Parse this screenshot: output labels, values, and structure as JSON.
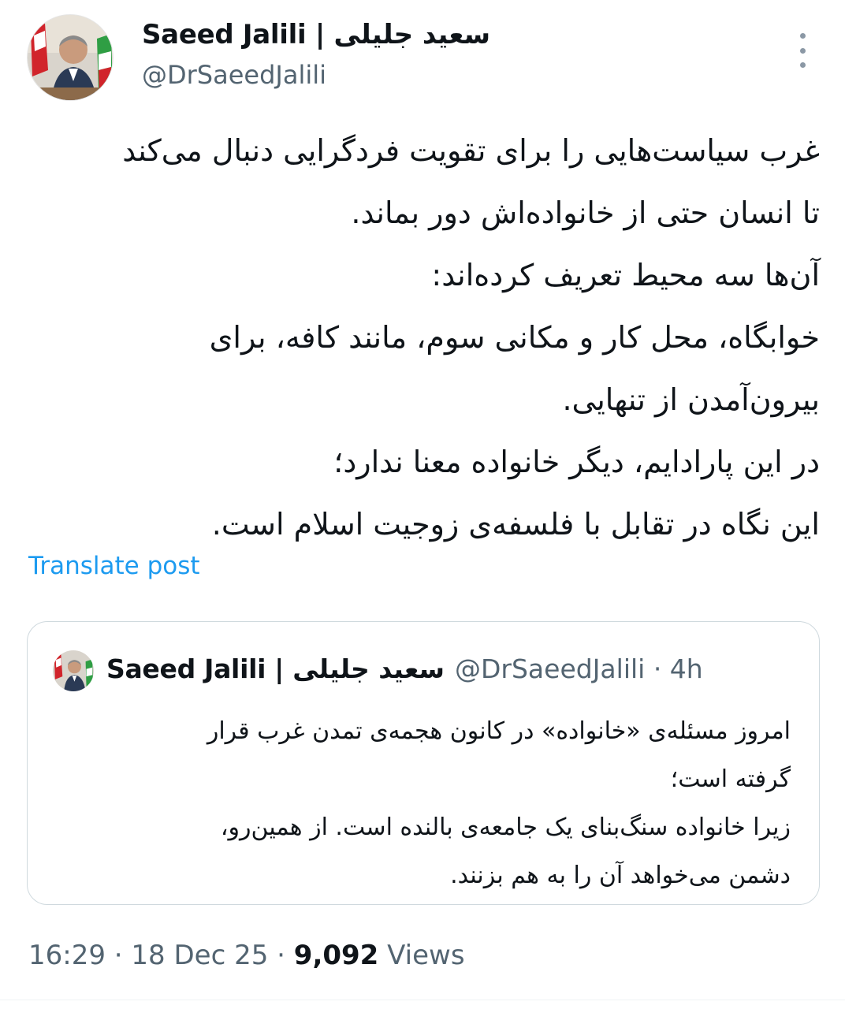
{
  "author": {
    "display_name": "Saeed Jalili | سعید جلیلی",
    "handle": "@DrSaeedJalili"
  },
  "post": {
    "lines": [
      "غرب سیاست‌هایی را برای تقویت فردگرایی دنبال می‌کند",
      "تا انسان حتی از خانواده‌اش دور بماند.",
      "آن‌ها سه محیط تعریف کرده‌اند:",
      "خوابگاه، محل کار و مکانی سوم، مانند کافه، برای",
      "بیرون‌آمدن از تنهایی.",
      "در این پارادایم، دیگر خانواده معنا ندارد؛",
      "این نگاه در تقابل با فلسفه‌ی زوجیت اسلام است."
    ],
    "translate_label": "Translate post"
  },
  "quoted_post": {
    "display_name": "Saeed Jalili | سعید جلیلی",
    "handle_time": "@DrSaeedJalili · 4h",
    "lines": [
      "امروز مسئله‌ی «خانواده» در کانون هجمه‌ی تمدن غرب قرار",
      "گرفته است؛",
      "زیرا خانواده سنگ‌بنای یک جامعه‌ی بالنده است. از همین‌رو،",
      "دشمن می‌خواهد آن را به هم بزنند."
    ]
  },
  "meta": {
    "time": "16:29",
    "date": "18 Dec 25",
    "views_count": "9,092",
    "views_label": "Views"
  },
  "icons": {
    "more": "more-vertical-icon",
    "avatar": "profile-photo"
  },
  "colors": {
    "link": "#1d9bf0",
    "secondary_text": "#536471",
    "border": "#cfd9de"
  }
}
